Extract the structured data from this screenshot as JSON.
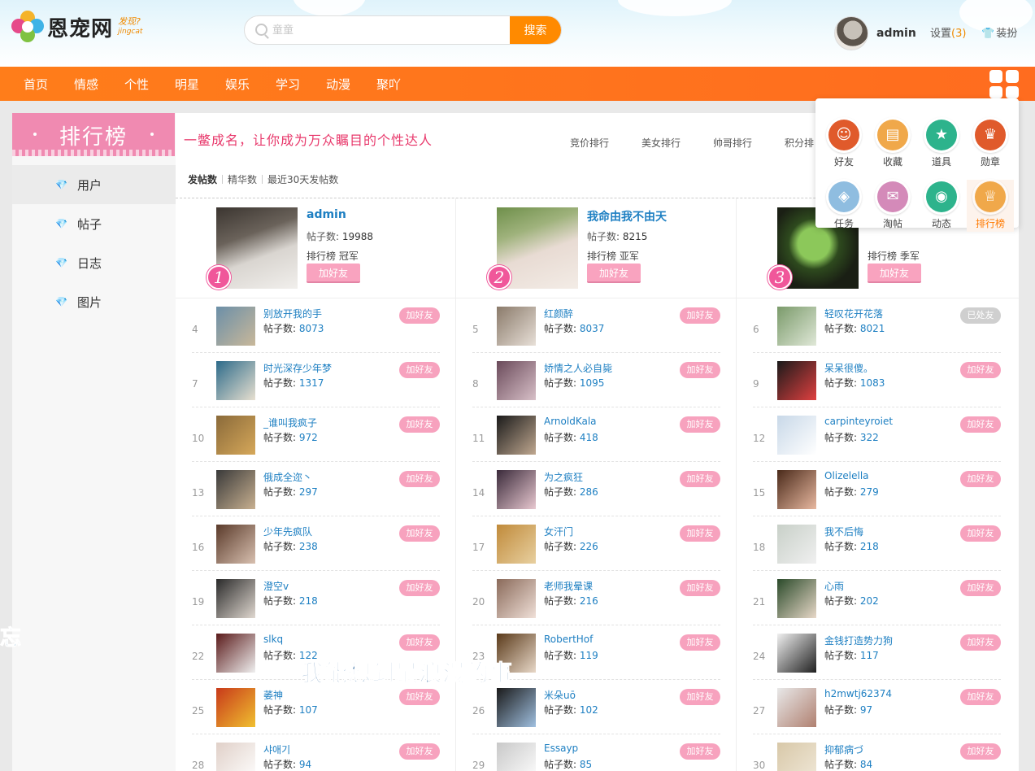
{
  "site": {
    "logo_text": "恩宠网",
    "logo_slogan": "发现?",
    "logo_domain": "jingcat"
  },
  "search": {
    "placeholder": "童童",
    "button_label": "搜索"
  },
  "user": {
    "name": "admin",
    "settings_label": "设置",
    "settings_count": "(3)",
    "dress_label": "装扮"
  },
  "nav": {
    "items": [
      "首页",
      "情感",
      "个性",
      "明星",
      "娱乐",
      "学习",
      "动漫",
      "聚吖"
    ]
  },
  "dropdown": {
    "items": [
      {
        "label": "好友",
        "icon": "friend-icon",
        "color": "#e05a2b"
      },
      {
        "label": "收藏",
        "icon": "folder-icon",
        "color": "#f0a84a"
      },
      {
        "label": "道具",
        "icon": "star-icon",
        "color": "#2db38c"
      },
      {
        "label": "勋章",
        "icon": "crown-icon",
        "color": "#e05a2b"
      },
      {
        "label": "任务",
        "icon": "shield-icon",
        "color": "#8fbde0"
      },
      {
        "label": "淘帖",
        "icon": "gift-icon",
        "color": "#d48ab9"
      },
      {
        "label": "动态",
        "icon": "bulb-icon",
        "color": "#2db38c"
      },
      {
        "label": "排行榜",
        "icon": "trophy-icon",
        "color": "#f0a84a"
      }
    ]
  },
  "sidebar": {
    "title": "排行榜",
    "items": [
      {
        "label": "用户",
        "active": true
      },
      {
        "label": "帖子",
        "active": false
      },
      {
        "label": "日志",
        "active": false
      },
      {
        "label": "图片",
        "active": false
      }
    ]
  },
  "main": {
    "slogan": "一鳖成名，让你成为万众瞩目的个性达人",
    "tabs": [
      "竞价排行",
      "美女排行",
      "帅哥排行",
      "积分排"
    ],
    "subtabs": [
      "发帖数",
      "精华数",
      "最近30天发帖数"
    ],
    "posts_label": "帖子数:",
    "add_label": "加好友",
    "added_label": "已处友"
  },
  "top3": [
    {
      "rank": "1",
      "name": "admin",
      "posts": "19988",
      "title": "排行榜 冠军"
    },
    {
      "rank": "2",
      "name": "我命由我不由天",
      "posts": "8215",
      "title": "排行榜 亚军"
    },
    {
      "rank": "3",
      "name": "",
      "posts": "",
      "title": "排行榜 季军"
    }
  ],
  "ranking": [
    [
      {
        "rank": "4",
        "name": "别放开我的手",
        "posts": "8073",
        "added": false
      },
      {
        "rank": "7",
        "name": "时光深存少年梦",
        "posts": "1317",
        "added": false
      },
      {
        "rank": "10",
        "name": "_谁叫我疯子",
        "posts": "972",
        "added": false
      },
      {
        "rank": "13",
        "name": "俄成全迩丶",
        "posts": "297",
        "added": false
      },
      {
        "rank": "16",
        "name": "少年先疯队",
        "posts": "238",
        "added": false
      },
      {
        "rank": "19",
        "name": "澄空v",
        "posts": "218",
        "added": false
      },
      {
        "rank": "22",
        "name": "slkq",
        "posts": "122",
        "added": false
      },
      {
        "rank": "25",
        "name": "萎神",
        "posts": "107",
        "added": false
      },
      {
        "rank": "28",
        "name": "샤애기",
        "posts": "94",
        "added": false
      }
    ],
    [
      {
        "rank": "5",
        "name": "红颜醉",
        "posts": "8037",
        "added": false
      },
      {
        "rank": "8",
        "name": "娇情之人必自毙",
        "posts": "1095",
        "added": false
      },
      {
        "rank": "11",
        "name": "ArnoldKala",
        "posts": "418",
        "added": false
      },
      {
        "rank": "14",
        "name": "为之疯狂",
        "posts": "286",
        "added": false
      },
      {
        "rank": "17",
        "name": "女汗门",
        "posts": "226",
        "added": false
      },
      {
        "rank": "20",
        "name": "老师我晕课",
        "posts": "216",
        "added": false
      },
      {
        "rank": "23",
        "name": "RobertHof",
        "posts": "119",
        "added": false
      },
      {
        "rank": "26",
        "name": "米朵uō",
        "posts": "102",
        "added": false
      },
      {
        "rank": "29",
        "name": "Essayp",
        "posts": "85",
        "added": false
      }
    ],
    [
      {
        "rank": "6",
        "name": "轻叹花开花落",
        "posts": "8021",
        "added": true
      },
      {
        "rank": "9",
        "name": "呆呆很傻。",
        "posts": "1083",
        "added": false
      },
      {
        "rank": "12",
        "name": "carpinteyroiet",
        "posts": "322",
        "added": false
      },
      {
        "rank": "15",
        "name": "Olizelella",
        "posts": "279",
        "added": false
      },
      {
        "rank": "18",
        "name": "我不后悔",
        "posts": "218",
        "added": false
      },
      {
        "rank": "21",
        "name": "心雨",
        "posts": "202",
        "added": false
      },
      {
        "rank": "24",
        "name": "金钱打造势力狗",
        "posts": "117",
        "added": false
      },
      {
        "rank": "27",
        "name": "h2mwtj62374",
        "posts": "97",
        "added": false
      },
      {
        "rank": "30",
        "name": "抑郁病づ",
        "posts": "84",
        "added": false
      }
    ]
  ],
  "overlay": {
    "subtitle_left": "忘",
    "subtitle_main": "我能想到最浪漫的事"
  },
  "colors": {
    "accent": "#ff7a1a",
    "pink": "#f08ab1",
    "link": "#1d7fc2"
  }
}
